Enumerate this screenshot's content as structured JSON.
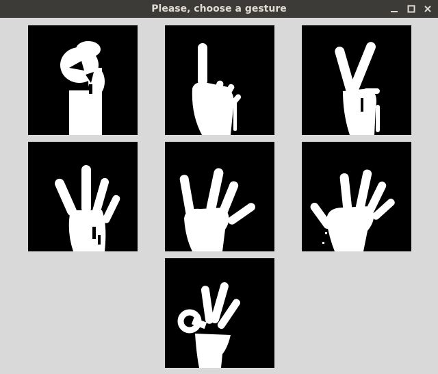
{
  "window": {
    "title": "Please, choose a gesture",
    "controls": [
      "minimize-icon",
      "maximize-icon",
      "close-icon"
    ]
  },
  "colors": {
    "titlebar": "#3c3b37",
    "title_text": "#dfdbd2",
    "background": "#d9d9d9",
    "tile_bg": "#000000",
    "hand": "#ffffff"
  },
  "gestures": [
    {
      "icon": "fist-gesture-icon"
    },
    {
      "icon": "one-finger-gesture-icon"
    },
    {
      "icon": "two-fingers-gesture-icon"
    },
    {
      "icon": "four-fingers-gesture-icon"
    },
    {
      "icon": "open-hand-gesture-icon"
    },
    {
      "icon": "spread-hand-gesture-icon"
    },
    {
      "icon": "ok-sign-gesture-icon"
    }
  ]
}
